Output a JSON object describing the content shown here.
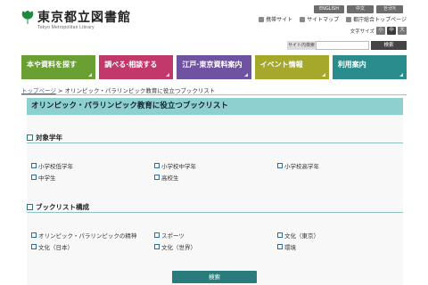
{
  "header": {
    "site_title": "東京都立図書館",
    "site_subtitle": "Tokyo Metropolitan Library",
    "lang": {
      "english": "ENGLISH",
      "chinese": "中文",
      "korean": "한국어"
    },
    "links": {
      "mobile": "携帯サイト",
      "sitemap": "サイトマップ",
      "portal": "都庁総合トップページ"
    },
    "font_size": {
      "label": "文字サイズ",
      "small": "小",
      "medium": "中",
      "large": "大"
    },
    "search": {
      "label": "サイト内検索",
      "placeholder": "",
      "button": "検索"
    }
  },
  "nav": {
    "items": [
      {
        "label": "本や資料を探す",
        "color": "#6aa033"
      },
      {
        "label": "調べる·相談する",
        "color": "#c2386b"
      },
      {
        "label": "江戸·東京資料案内",
        "color": "#6f53a0"
      },
      {
        "label": "イベント情報",
        "color": "#a6a82c"
      },
      {
        "label": "利用案内",
        "color": "#2a8c8c"
      }
    ]
  },
  "breadcrumb": {
    "home": "トップページ",
    "separator": ">",
    "current": "オリンピック・パラリンピック教育に役立つブックリスト"
  },
  "page_title": "オリンピック・パラリンピック教育に役立つブックリスト",
  "sections": {
    "grade": {
      "title": "対象学年",
      "options": [
        "小学校低学年",
        "小学校中学年",
        "小学校高学年",
        "中学生",
        "高校生"
      ]
    },
    "booklist": {
      "title": "ブックリスト構成",
      "options": [
        "オリンピック・パラリンピックの精神",
        "スポーツ",
        "文化（東京）",
        "文化（日本）",
        "文化（世界）",
        "環境"
      ]
    }
  },
  "submit_label": "検索",
  "colors": {
    "accent": "#2a7c7c",
    "title_bar": "#8ecfcf"
  }
}
